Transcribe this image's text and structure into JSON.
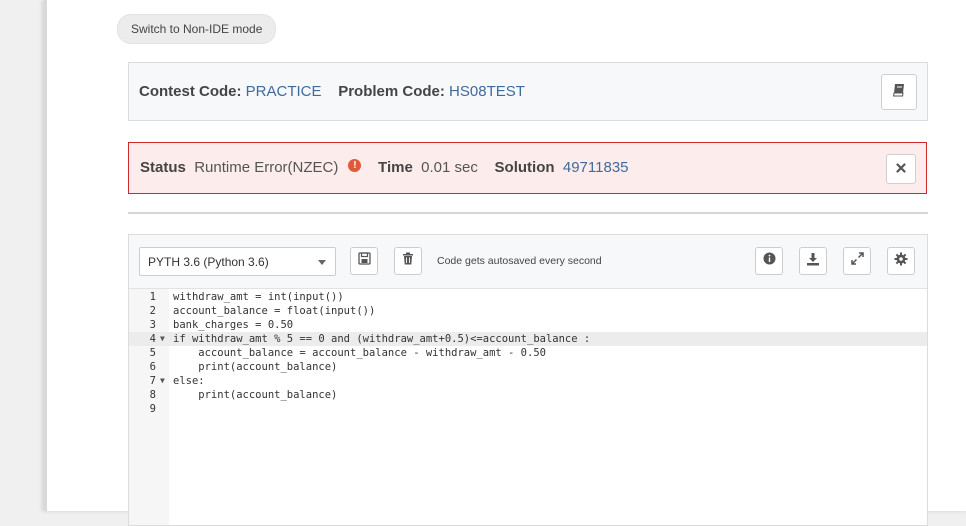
{
  "mode_button": "Switch to Non-IDE mode",
  "problem": {
    "contest_label": "Contest Code:",
    "contest_value": "PRACTICE",
    "problem_label": "Problem Code:",
    "problem_value": "HS08TEST"
  },
  "status": {
    "status_label": "Status",
    "status_value": "Runtime Error(NZEC)",
    "time_label": "Time",
    "time_value": "0.01 sec",
    "solution_label": "Solution",
    "solution_value": "49711835",
    "error_glyph": "!"
  },
  "editor": {
    "language": "PYTH 3.6 (Python 3.6)",
    "autosave_text": "Code gets autosaved every second",
    "code_lines": [
      {
        "n": "1",
        "text": "withdraw_amt = int(input())"
      },
      {
        "n": "2",
        "text": "account_balance = float(input())"
      },
      {
        "n": "3",
        "text": "bank_charges = 0.50"
      },
      {
        "n": "4",
        "text": "if withdraw_amt % 5 == 0 and (withdraw_amt+0.5)<=account_balance :"
      },
      {
        "n": "5",
        "text": "    account_balance = account_balance - withdraw_amt - 0.50"
      },
      {
        "n": "6",
        "text": "    print(account_balance)"
      },
      {
        "n": "7",
        "text": "else:"
      },
      {
        "n": "8",
        "text": "    print(account_balance)"
      },
      {
        "n": "9",
        "text": ""
      }
    ]
  },
  "colors": {
    "error_border": "#d12a2a",
    "error_bg": "#fcecec",
    "link": "#3e6a9c"
  }
}
